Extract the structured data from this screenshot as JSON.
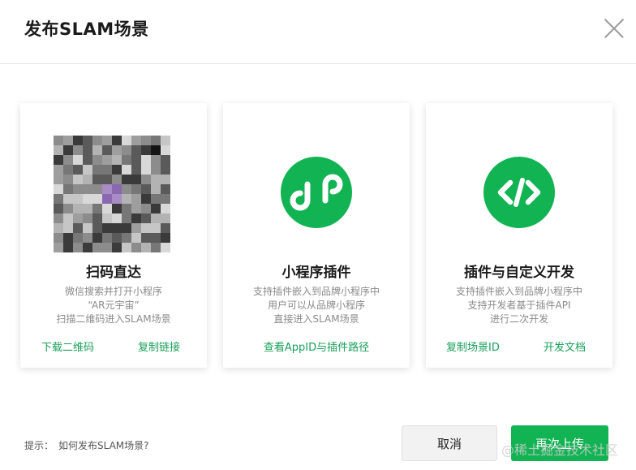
{
  "dialog": {
    "title": "发布SLAM场景"
  },
  "cards": [
    {
      "title": "扫码直达",
      "desc": [
        "微信搜索并打开小程序",
        "“AR元宇宙”",
        "扫描二维码进入SLAM场景"
      ],
      "links": [
        "下载二维码",
        "复制链接"
      ]
    },
    {
      "title": "小程序插件",
      "desc": [
        "支持插件嵌入到品牌小程序中",
        "用户可以从品牌小程序",
        "直接进入SLAM场景"
      ],
      "links": [
        "查看AppID与插件路径"
      ]
    },
    {
      "title": "插件与自定义开发",
      "desc": [
        "支持插件嵌入到品牌小程序中",
        "支持开发者基于插件API",
        "进行二次开发"
      ],
      "links": [
        "复制场景ID",
        "开发文档"
      ]
    }
  ],
  "footer": {
    "tip_label": "提示：",
    "tip_link": "如何发布SLAM场景?",
    "cancel": "取消",
    "reupload": "再次上传"
  },
  "watermark": "@稀土掘金技术社区",
  "colors": {
    "accent": "#12b353",
    "link": "#19a05a"
  },
  "icons": {
    "card1": "qr-code-image",
    "card2": "mini-program-icon",
    "card3": "code-brackets-icon"
  }
}
